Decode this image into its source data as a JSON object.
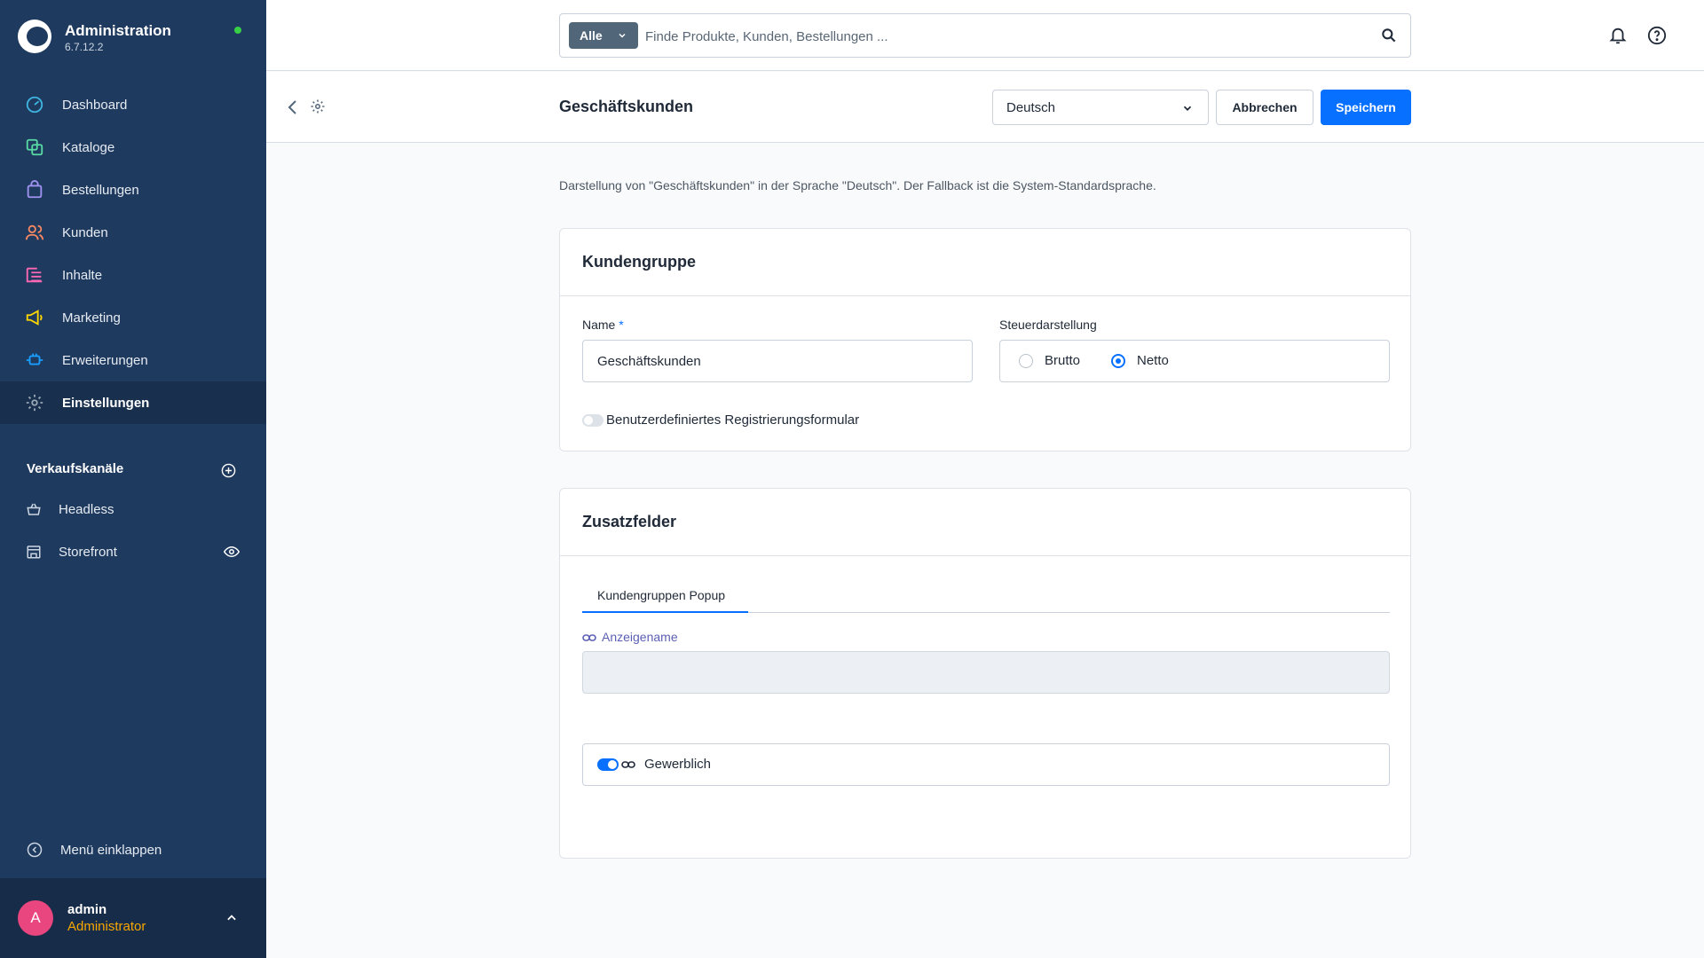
{
  "app": {
    "title": "Administration",
    "version": "6.7.12.2"
  },
  "sidebar": {
    "items": [
      {
        "label": "Dashboard",
        "icon": "dashboard-icon",
        "color": "#3fb4e0"
      },
      {
        "label": "Kataloge",
        "icon": "catalog-icon",
        "color": "#57d9a3"
      },
      {
        "label": "Bestellungen",
        "icon": "shopping-bag-icon",
        "color": "#a092f0"
      },
      {
        "label": "Kunden",
        "icon": "users-icon",
        "color": "#f88962"
      },
      {
        "label": "Inhalte",
        "icon": "content-icon",
        "color": "#ff68b4"
      },
      {
        "label": "Marketing",
        "icon": "megaphone-icon",
        "color": "#ffd700"
      },
      {
        "label": "Erweiterungen",
        "icon": "plug-icon",
        "color": "#189eff"
      },
      {
        "label": "Einstellungen",
        "icon": "gear-icon",
        "color": "#9aa8b5",
        "active": true
      }
    ],
    "sales_channels_heading": "Verkaufskanäle",
    "sales_channels": [
      {
        "label": "Headless",
        "icon": "basket-icon"
      },
      {
        "label": "Storefront",
        "icon": "storefront-icon"
      }
    ],
    "collapse_label": "Menü einklappen"
  },
  "user": {
    "initial": "A",
    "name": "admin",
    "role": "Administrator"
  },
  "search": {
    "filter_label": "Alle",
    "placeholder": "Finde Produkte, Kunden, Bestellungen ..."
  },
  "smartbar": {
    "title": "Geschäftskunden",
    "language": "Deutsch",
    "cancel_label": "Abbrechen",
    "save_label": "Speichern"
  },
  "info_text": "Darstellung von \"Geschäftskunden\" in der Sprache \"Deutsch\". Der Fallback ist die System-Standardsprache.",
  "customer_group": {
    "heading": "Kundengruppe",
    "name_label": "Name",
    "required_mark": "*",
    "name_value": "Geschäftskunden",
    "tax_label": "Steuerdarstellung",
    "tax_options": [
      "Brutto",
      "Netto"
    ],
    "tax_selected": "Netto",
    "registration_toggle_label": "Benutzerdefiniertes Registrierungsformular",
    "registration_toggle_on": false
  },
  "custom_fields": {
    "heading": "Zusatzfelder",
    "tab_label": "Kundengruppen Popup",
    "display_name_label": "Anzeigename",
    "display_name_value": "",
    "commercial_label": "Gewerblich",
    "commercial_on": true
  },
  "colors": {
    "accent": "#0870ff",
    "sidebar": "#1f3a5f",
    "role": "#f7a600",
    "online": "#37d046"
  }
}
